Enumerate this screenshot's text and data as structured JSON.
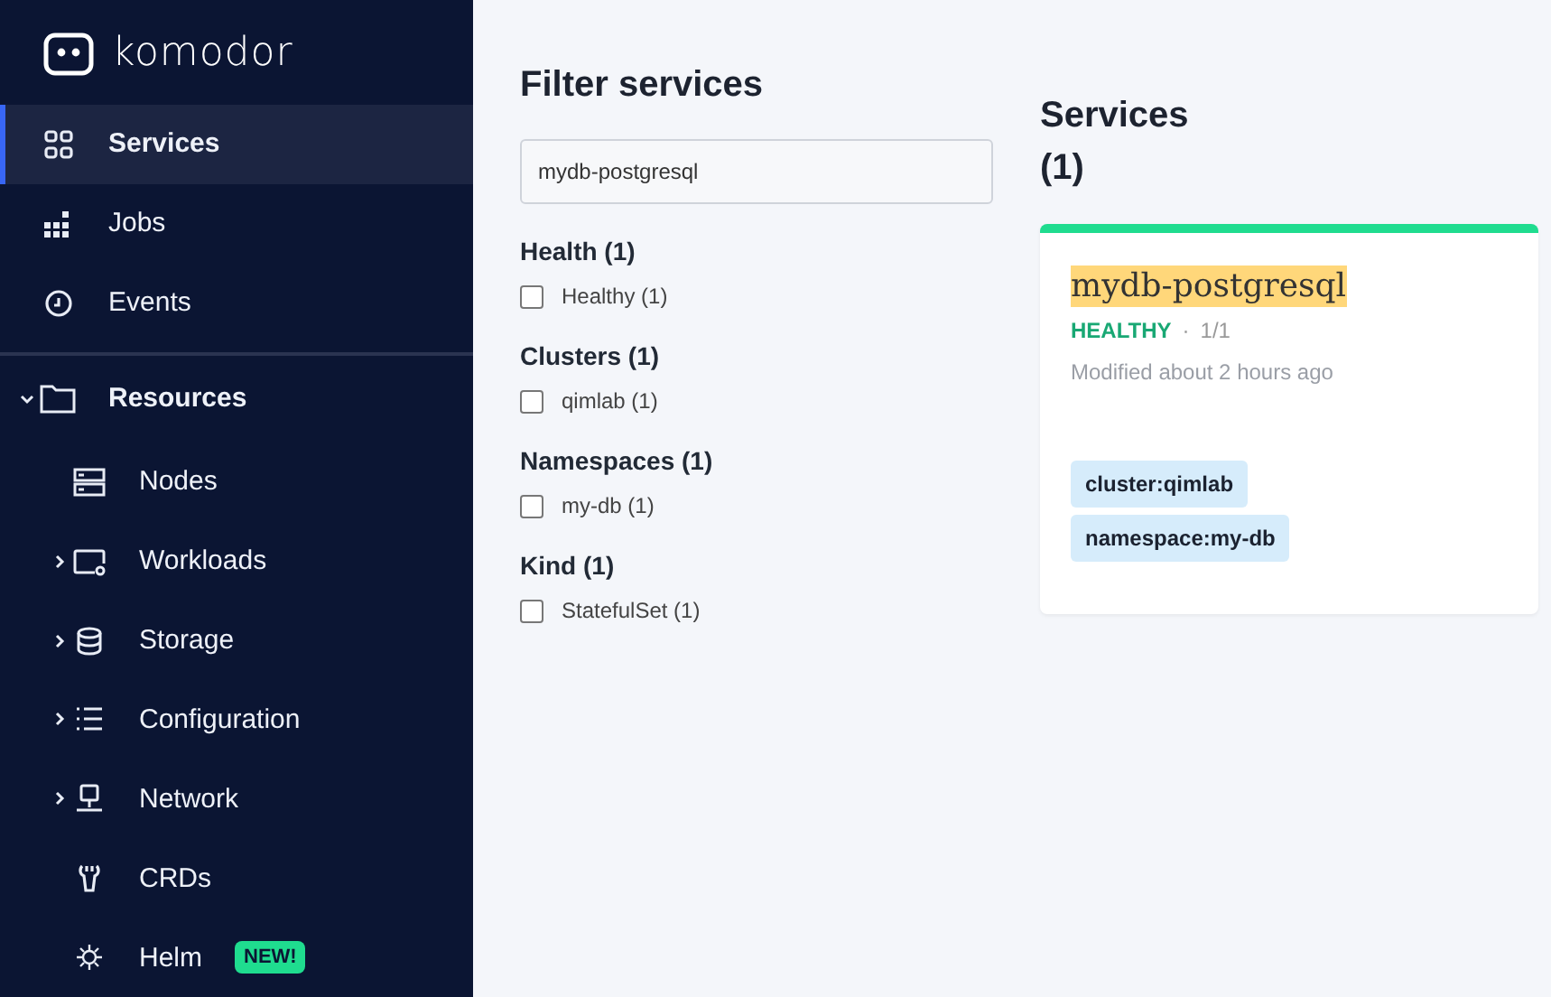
{
  "logo": {
    "text": "komodor"
  },
  "nav": [
    {
      "label": "Services",
      "selected": true
    },
    {
      "label": "Jobs",
      "selected": false
    },
    {
      "label": "Events",
      "selected": false
    }
  ],
  "resources": {
    "label": "Resources",
    "expanded": true,
    "children": [
      {
        "label": "Nodes"
      },
      {
        "label": "Workloads",
        "expanded": false
      },
      {
        "label": "Storage",
        "expanded": false
      },
      {
        "label": "Configuration",
        "expanded": false
      },
      {
        "label": "Network",
        "expanded": false
      },
      {
        "label": "CRDs"
      },
      {
        "label": "Helm",
        "badge": "NEW!"
      }
    ]
  },
  "filter": {
    "title": "Filter services",
    "search": {
      "value": "mydb-postgresql"
    },
    "groups": [
      {
        "title": "Health (1)",
        "options": [
          {
            "label": "Healthy (1)",
            "checked": false
          }
        ]
      },
      {
        "title": "Clusters (1)",
        "options": [
          {
            "label": "qimlab (1)",
            "checked": false
          }
        ]
      },
      {
        "title": "Namespaces (1)",
        "options": [
          {
            "label": "my-db (1)",
            "checked": false
          }
        ]
      },
      {
        "title": "Kind (1)",
        "options": [
          {
            "label": "StatefulSet (1)",
            "checked": false
          }
        ]
      }
    ]
  },
  "services": {
    "title": "Services",
    "count": "(1)",
    "cards": [
      {
        "name": "mydb-postgresql",
        "status": "HEALTHY",
        "separator": "·",
        "color": "#1fdc8f",
        "replicas": "1/1",
        "modified": "Modified about 2 hours ago",
        "tags": [
          "cluster:qimlab",
          "namespace:my-db"
        ]
      }
    ]
  }
}
